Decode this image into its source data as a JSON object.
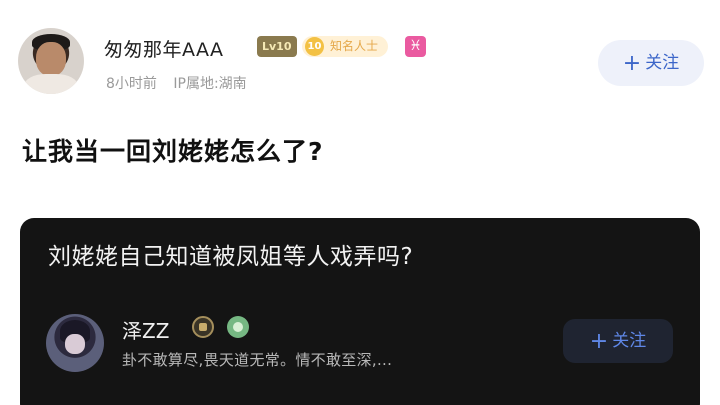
{
  "author": {
    "name": "匆匆那年AAA",
    "level_badge": "Lv10",
    "fame_badge": {
      "icon_text": "10",
      "label": "知名人士"
    },
    "zodiac_badge": "♓",
    "time": "8小时前",
    "ip_location": "IP属地:湖南",
    "follow_label": "关注",
    "follow_icon": "+"
  },
  "post": {
    "title": "让我当一回刘姥姥怎么了?"
  },
  "quoted_card": {
    "question": "刘姥姥自己知道被凤姐等人戏弄吗?",
    "user": {
      "name": "泽ZZ",
      "bio": "卦不敢算尽,畏天道无常。情不敢至深,...",
      "follow_label": "关注",
      "follow_icon": "+"
    }
  },
  "colors": {
    "accent": "#3c66c9",
    "card_bg": "#141414",
    "zodiac_badge": "#ea5aa0",
    "level_badge": "#8a7a4e",
    "fame_badge_bg": "#fff1d6"
  }
}
